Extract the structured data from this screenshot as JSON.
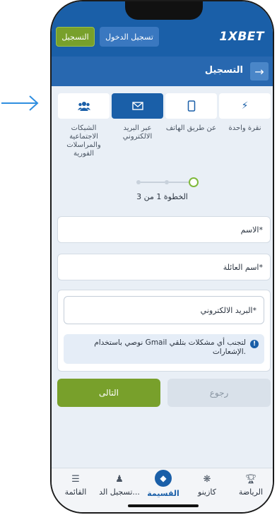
{
  "header": {
    "logo": "1XBET",
    "login_label": "تسجيل الدخول",
    "register_label": "التسجيل"
  },
  "subheader": {
    "title": "التسجيل"
  },
  "methods": [
    {
      "label": "نقرة واحدة",
      "icon": "lightning-icon"
    },
    {
      "label": "عن طريق الهاتف",
      "icon": "phone-icon"
    },
    {
      "label": "عبر البريد الالكتروني",
      "icon": "envelope-icon"
    },
    {
      "label": "الشبكات الاجتماعية والمراسلات الفورية",
      "icon": "users-icon"
    }
  ],
  "steps": {
    "text": "الخطوة 1 من 3"
  },
  "form": {
    "first_name": "الاسم*",
    "last_name": "اسم العائلة*",
    "email": "البريد الالكتروني*",
    "notice": "نوصي باستخدام Gmail لتجنب أي مشكلات بتلقي الإشعارات."
  },
  "actions": {
    "next": "التالى",
    "back": "رجوع"
  },
  "bottom_nav": [
    {
      "label": "الرياضة",
      "icon": "trophy-icon"
    },
    {
      "label": "كازينو",
      "icon": "chip-icon"
    },
    {
      "label": "القسيمة",
      "icon": "ticket-icon"
    },
    {
      "label": "تسجيل الد...",
      "icon": "user-icon"
    },
    {
      "label": "القائمة",
      "icon": "menu-icon"
    }
  ],
  "colors": {
    "primary": "#1a5fa8",
    "accent_green": "#78a02b",
    "arrow": "#2f8ee0"
  }
}
